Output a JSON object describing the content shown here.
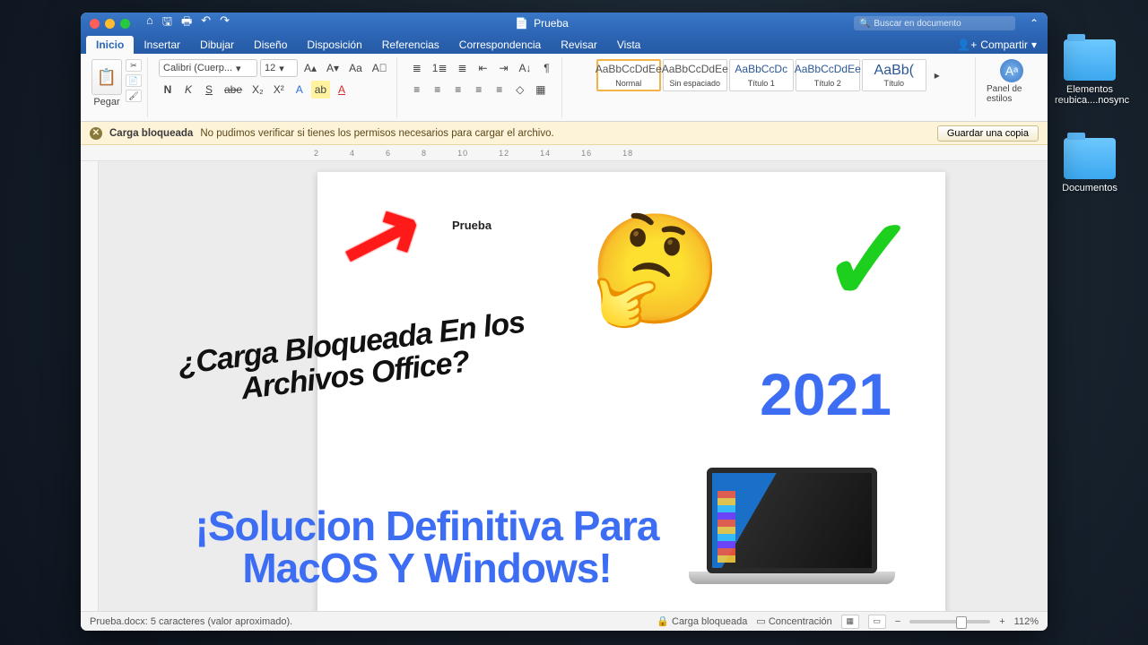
{
  "desktop": {
    "folders": [
      "Elementos reubica....nosync",
      "Documentos"
    ]
  },
  "titlebar": {
    "doc_name": "Prueba",
    "search_placeholder": "Buscar en documento"
  },
  "tabs": [
    "Inicio",
    "Insertar",
    "Dibujar",
    "Diseño",
    "Disposición",
    "Referencias",
    "Correspondencia",
    "Revisar",
    "Vista"
  ],
  "share_label": "Compartir",
  "ribbon": {
    "paste": "Pegar",
    "font_name": "Calibri (Cuerp...",
    "font_size": "12",
    "bold": "N",
    "italic": "K",
    "underline": "S",
    "strike": "abe",
    "sub": "X₂",
    "sup": "X²",
    "grow": "A▴",
    "shrink": "A▾",
    "changecase": "Aa",
    "clear": "A⃠",
    "fontcolor": "A",
    "highlight": "ab",
    "textfx": "A",
    "bullets": "≣",
    "numbers": "1≣",
    "multilevel": "≣",
    "indentL": "⇤",
    "indentR": "⇥",
    "sort": "A↓",
    "pilcrow": "¶",
    "alignL": "≡",
    "alignC": "≡",
    "alignR": "≡",
    "justify": "≡",
    "linesp": "≡",
    "shading": "◇",
    "borders": "▦",
    "styles": [
      {
        "preview": "AaBbCcDdEe",
        "name": "Normal",
        "grey": true,
        "selected": true
      },
      {
        "preview": "AaBbCcDdEe",
        "name": "Sin espaciado",
        "grey": true
      },
      {
        "preview": "AaBbCcDc",
        "name": "Título 1"
      },
      {
        "preview": "AaBbCcDdEe",
        "name": "Título 2"
      },
      {
        "preview": "AaBb(",
        "name": "Título"
      }
    ],
    "styles_pane": "Panel de estilos"
  },
  "warning": {
    "title": "Carga bloqueada",
    "msg": "No pudimos verificar si tienes los permisos necesarios para cargar el archivo.",
    "button": "Guardar una copia"
  },
  "ruler_marks": [
    "2",
    "4",
    "6",
    "8",
    "10",
    "12",
    "14",
    "16",
    "18"
  ],
  "page_text": "Prueba",
  "overlay": {
    "question": "¿Carga Bloqueada En los Archivos Office?",
    "year": "2021",
    "solution": "¡Solucion Definitiva Para MacOS Y Windows!",
    "think": "🤔",
    "check": "✓"
  },
  "status": {
    "left": "Prueba.docx: 5 caracteres (valor aproximado).",
    "blocked": "Carga bloqueada",
    "focus": "Concentración",
    "zoom": "112%"
  }
}
